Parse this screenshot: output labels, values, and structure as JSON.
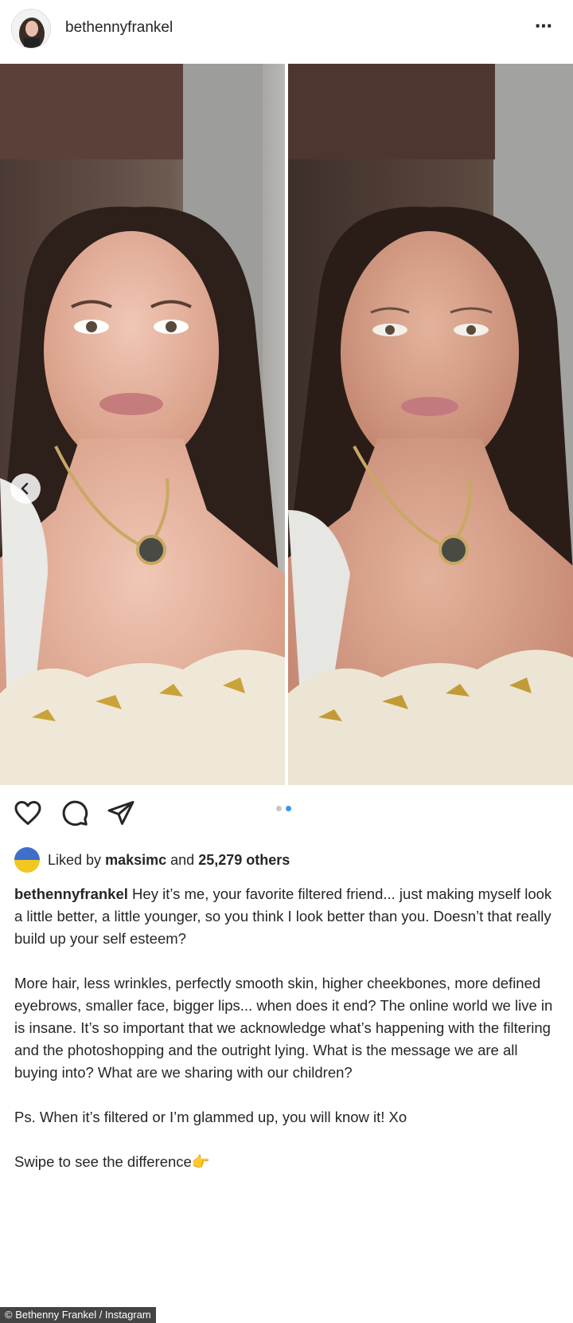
{
  "post": {
    "username": "bethennyfrankel",
    "more_icon": "⋯",
    "media": {
      "slide_total": 2,
      "slide_active": 2,
      "colors": {
        "hair": "#2d1f1a",
        "skin": "#e3b39e",
        "background": "#8a8a8a"
      }
    },
    "likes": {
      "prefix": "Liked by",
      "user": "maksimc",
      "middle": "and",
      "others": "25,279 others"
    },
    "caption": {
      "user": "bethennyfrankel",
      "p1": "Hey it’s me, your favorite filtered friend... just making myself look a little better, a little younger, so you think I look better than you. Doesn’t that really build up your self esteem?",
      "p2": "More hair, less wrinkles, perfectly smooth skin, higher cheekbones, more defined eyebrows, smaller face, bigger lips... when does it end? The online world we live in is insane. It’s so important that we acknowledge what’s happening with the filtering and the photoshopping and the outright lying. What is the message we are all buying into? What are we sharing with our children?",
      "p3": "Ps. When it’s filtered or I’m glammed up, you will know it! Xo",
      "p4": "Swipe to see the difference👉"
    },
    "credit": "© Bethenny Frankel / Instagram"
  }
}
